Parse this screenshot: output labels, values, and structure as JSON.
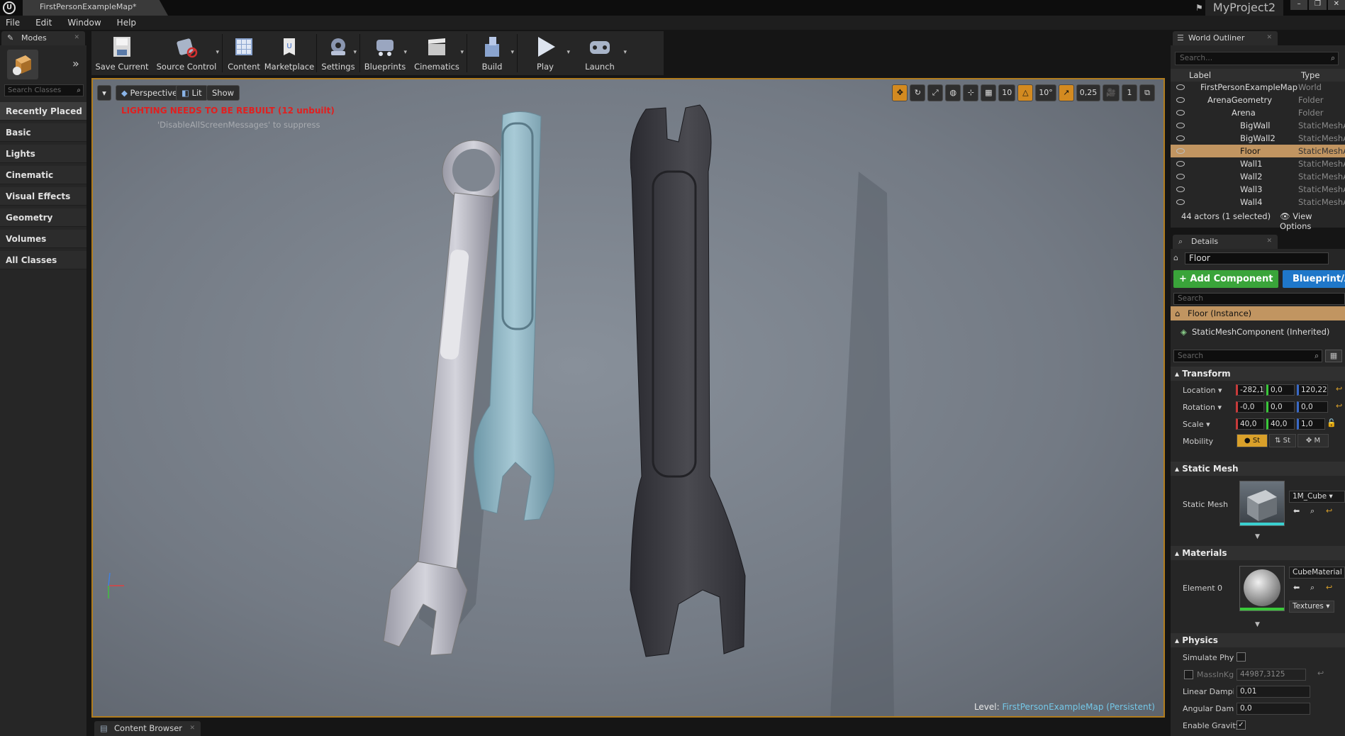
{
  "window": {
    "doc_tab": "FirstPersonExampleMap*",
    "project": "MyProject2",
    "controls": [
      "–",
      "❐",
      "✕"
    ]
  },
  "menu": [
    "File",
    "Edit",
    "Window",
    "Help"
  ],
  "modes": {
    "tab": "Modes",
    "search_placeholder": "Search Classes",
    "categories": [
      "Recently Placed",
      "Basic",
      "Lights",
      "Cinematic",
      "Visual Effects",
      "Geometry",
      "Volumes",
      "All Classes"
    ]
  },
  "toolbar": {
    "buttons": [
      "Save Current",
      "Source Control",
      "Content",
      "Marketplace",
      "Settings",
      "Blueprints",
      "Cinematics",
      "Build",
      "Play",
      "Launch"
    ]
  },
  "viewport": {
    "perspective": "Perspective",
    "lit": "Lit",
    "show": "Show",
    "warning": "LIGHTING NEEDS TO BE REBUILT (12 unbuilt)",
    "hint": "'DisableAllScreenMessages' to suppress",
    "grid_snap": "10",
    "rot_snap": "10°",
    "scale_snap": "0,25",
    "cam_speed": "1",
    "level_prefix": "Level:",
    "level_name": "FirstPersonExampleMap (Persistent)"
  },
  "content_browser": {
    "tab": "Content Browser"
  },
  "outliner": {
    "tab": "World Outliner",
    "search_placeholder": "Search...",
    "col_label": "Label",
    "col_type": "Type",
    "rows": [
      {
        "label": "FirstPersonExampleMap",
        "type": "World"
      },
      {
        "label": "ArenaGeometry",
        "type": "Folder"
      },
      {
        "label": "Arena",
        "type": "Folder"
      },
      {
        "label": "BigWall",
        "type": "StaticMeshActor"
      },
      {
        "label": "BigWall2",
        "type": "StaticMeshActor"
      },
      {
        "label": "Floor",
        "type": "StaticMeshActor"
      },
      {
        "label": "Wall1",
        "type": "StaticMeshActor"
      },
      {
        "label": "Wall2",
        "type": "StaticMeshActor"
      },
      {
        "label": "Wall3",
        "type": "StaticMeshActor"
      },
      {
        "label": "Wall4",
        "type": "StaticMeshActor"
      }
    ],
    "actor_count": "44 actors (1 selected)",
    "view_options": "View Options"
  },
  "details": {
    "tab": "Details",
    "actor_name": "Floor",
    "add_component": "+ Add Component",
    "blueprint": "Blueprint/Add Script",
    "search_placeholder": "Search",
    "components": [
      "Floor (Instance)",
      "StaticMeshComponent (Inherited)"
    ],
    "transform": {
      "title": "Transform",
      "location_label": "Location",
      "location": [
        "-282,1",
        "0,0",
        "120,22"
      ],
      "rotation_label": "Rotation",
      "rotation": [
        "-0,0",
        "0,0",
        "0,0"
      ],
      "scale_label": "Scale",
      "scale": [
        "40,0",
        "40,0",
        "1,0"
      ],
      "mobility_label": "Mobility",
      "mobility": [
        "St",
        "St",
        "M"
      ]
    },
    "static_mesh": {
      "title": "Static Mesh",
      "label": "Static Mesh",
      "value": "1M_Cube"
    },
    "materials": {
      "title": "Materials",
      "element_label": "Element 0",
      "value": "CubeMaterial",
      "textures": "Textures"
    },
    "physics": {
      "title": "Physics",
      "simulate": "Simulate Physics",
      "mass_label": "MassInKg",
      "mass": "44987,3125",
      "linear_label": "Linear Damping",
      "linear": "0,01",
      "angular_label": "Angular Damping",
      "angular": "0,0",
      "gravity": "Enable Gravity"
    }
  }
}
